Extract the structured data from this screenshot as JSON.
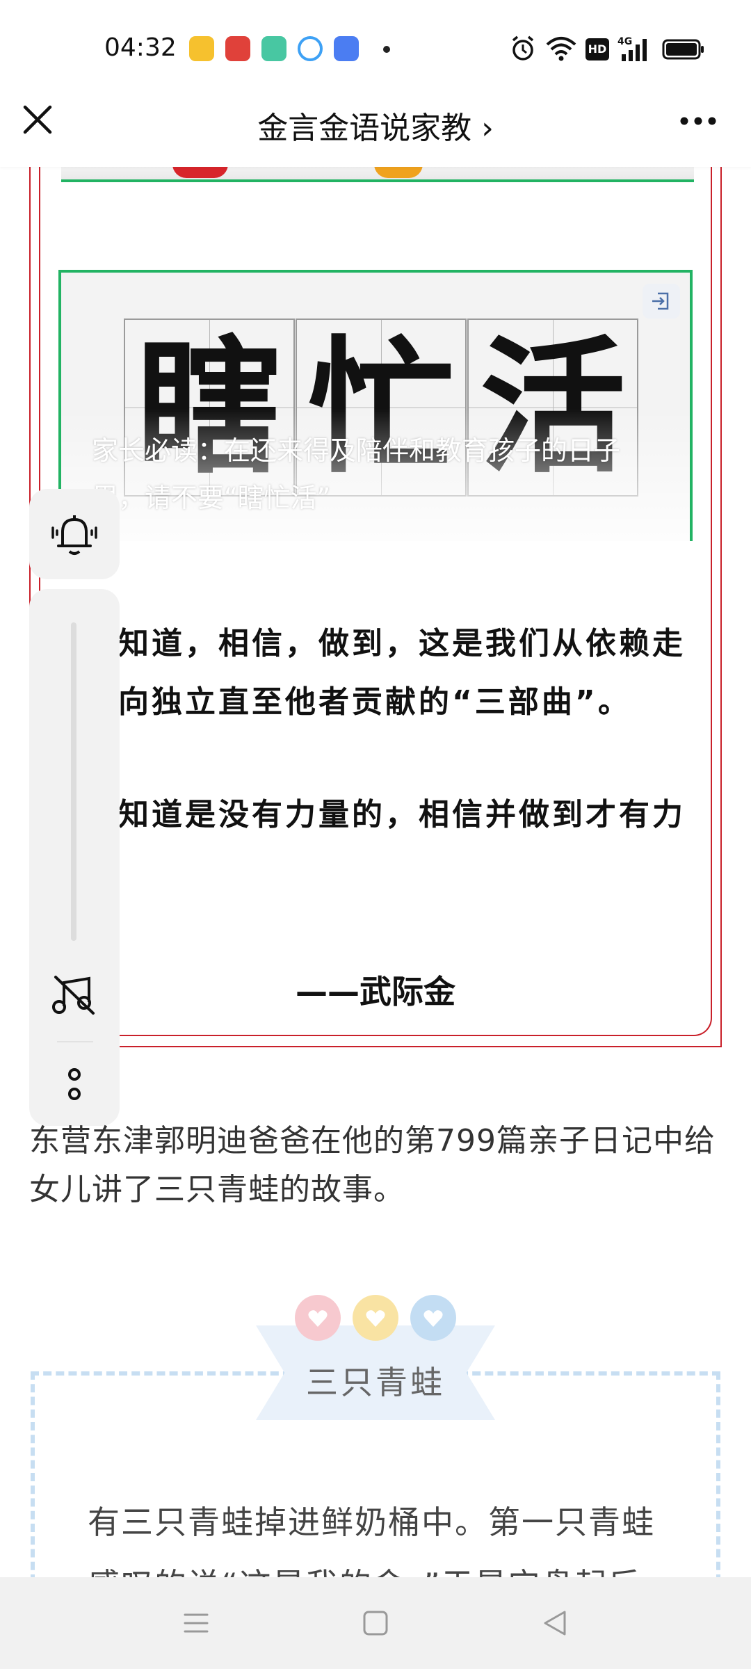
{
  "status_bar": {
    "time": "04:32",
    "app_icon_colors": [
      "#f6c12e",
      "#e0413a",
      "#48c7a2",
      "#3ea1f5",
      "#4b7df2"
    ],
    "right_icons": [
      "alarm-icon",
      "wifi-icon",
      "hd-icon",
      "4g-signal-icon",
      "battery-icon"
    ],
    "hd_label": "HD",
    "network_label": "4G"
  },
  "nav": {
    "title": "金言金语说家教",
    "chevron": "›"
  },
  "article_image": {
    "characters": [
      "瞎",
      "忙",
      "活"
    ],
    "caption": "家长必读：在还来得及陪伴和教育孩子的日子里，请不要“瞎忙活”"
  },
  "quote": {
    "line1": "知道，相信，做到，这是我们从依赖走",
    "line2": "向独立直至他者贡献的“三部曲”。",
    "line3": "知道是没有力量的，相信并做到才有力",
    "author": "——武际金"
  },
  "body": {
    "paragraph": "东营东津郭明迪爸爸在他的第799篇亲子日记中给女儿讲了三只青蛙的故事。"
  },
  "section": {
    "title": "三只青蛙",
    "heart_colors": [
      "#f7c9cf",
      "#f9e3a3",
      "#c3ddf3"
    ],
    "text": "有三只青蛙掉进鲜奶桶中。第一只青蛙感叹的说“这是我的命。”于是它盘起后"
  },
  "colors": {
    "frame_red": "#c9202a",
    "image_border_green": "#22b363",
    "dashed_blue": "#c7def2"
  }
}
